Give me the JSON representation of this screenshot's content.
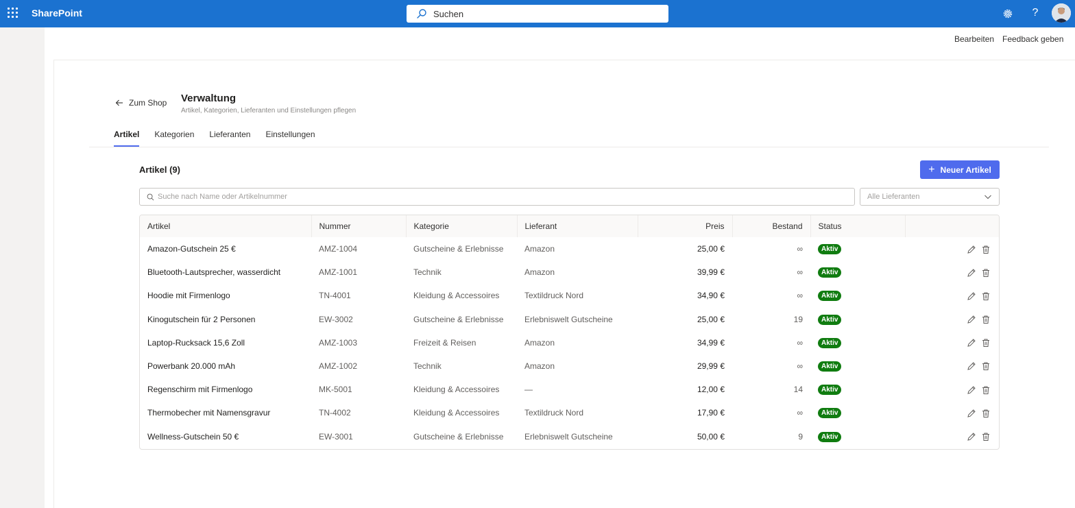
{
  "suite": {
    "brand": "SharePoint",
    "search_label": "Suchen",
    "help_label": "?",
    "accent": "#1b72d0"
  },
  "commands": {
    "edit": "Bearbeiten",
    "feedback": "Feedback geben"
  },
  "page": {
    "back_label": "Zum Shop",
    "title": "Verwaltung",
    "subtitle": "Artikel, Kategorien, Lieferanten und Einstellungen pflegen"
  },
  "tabs": [
    {
      "label": "Artikel",
      "active": true
    },
    {
      "label": "Kategorien",
      "active": false
    },
    {
      "label": "Lieferanten",
      "active": false
    },
    {
      "label": "Einstellungen",
      "active": false
    }
  ],
  "section": {
    "title": "Artikel (9)",
    "new_button": "Neuer Artikel",
    "new_button_icon": "+",
    "search_placeholder": "Suche nach Name oder Artikelnummer",
    "supplier_filter": "Alle Lieferanten"
  },
  "table": {
    "columns": [
      "Artikel",
      "Nummer",
      "Kategorie",
      "Lieferant",
      "Preis",
      "Bestand",
      "Status",
      ""
    ],
    "rows": [
      {
        "name": "Amazon-Gutschein 25 €",
        "number": "AMZ-1004",
        "category": "Gutscheine & Erlebnisse",
        "supplier": "Amazon",
        "price": "25,00 €",
        "stock": "∞",
        "status": "Aktiv"
      },
      {
        "name": "Bluetooth-Lautsprecher, wasserdicht",
        "number": "AMZ-1001",
        "category": "Technik",
        "supplier": "Amazon",
        "price": "39,99 €",
        "stock": "∞",
        "status": "Aktiv"
      },
      {
        "name": "Hoodie mit Firmenlogo",
        "number": "TN-4001",
        "category": "Kleidung & Accessoires",
        "supplier": "Textildruck Nord",
        "price": "34,90 €",
        "stock": "∞",
        "status": "Aktiv"
      },
      {
        "name": "Kinogutschein für 2 Personen",
        "number": "EW-3002",
        "category": "Gutscheine & Erlebnisse",
        "supplier": "Erlebniswelt Gutscheine",
        "price": "25,00 €",
        "stock": "19",
        "status": "Aktiv"
      },
      {
        "name": "Laptop-Rucksack 15,6 Zoll",
        "number": "AMZ-1003",
        "category": "Freizeit & Reisen",
        "supplier": "Amazon",
        "price": "34,99 €",
        "stock": "∞",
        "status": "Aktiv"
      },
      {
        "name": "Powerbank 20.000 mAh",
        "number": "AMZ-1002",
        "category": "Technik",
        "supplier": "Amazon",
        "price": "29,99 €",
        "stock": "∞",
        "status": "Aktiv"
      },
      {
        "name": "Regenschirm mit Firmenlogo",
        "number": "MK-5001",
        "category": "Kleidung & Accessoires",
        "supplier": "—",
        "price": "12,00 €",
        "stock": "14",
        "status": "Aktiv"
      },
      {
        "name": "Thermobecher mit Namensgravur",
        "number": "TN-4002",
        "category": "Kleidung & Accessoires",
        "supplier": "Textildruck Nord",
        "price": "17,90 €",
        "stock": "∞",
        "status": "Aktiv"
      },
      {
        "name": "Wellness-Gutschein 50 €",
        "number": "EW-3001",
        "category": "Gutscheine & Erlebnisse",
        "supplier": "Erlebniswelt Gutscheine",
        "price": "50,00 €",
        "stock": "9",
        "status": "Aktiv"
      }
    ]
  },
  "colors": {
    "primary_button": "#4f6bed",
    "status_active": "#107c10"
  },
  "icons": {
    "app_launcher": "waffle-icon",
    "search": "search-icon",
    "settings": "gear-icon",
    "help": "help-icon",
    "back": "arrow-left-icon",
    "dropdown": "chevron-down-icon",
    "edit": "pencil-icon",
    "delete": "trash-icon"
  }
}
